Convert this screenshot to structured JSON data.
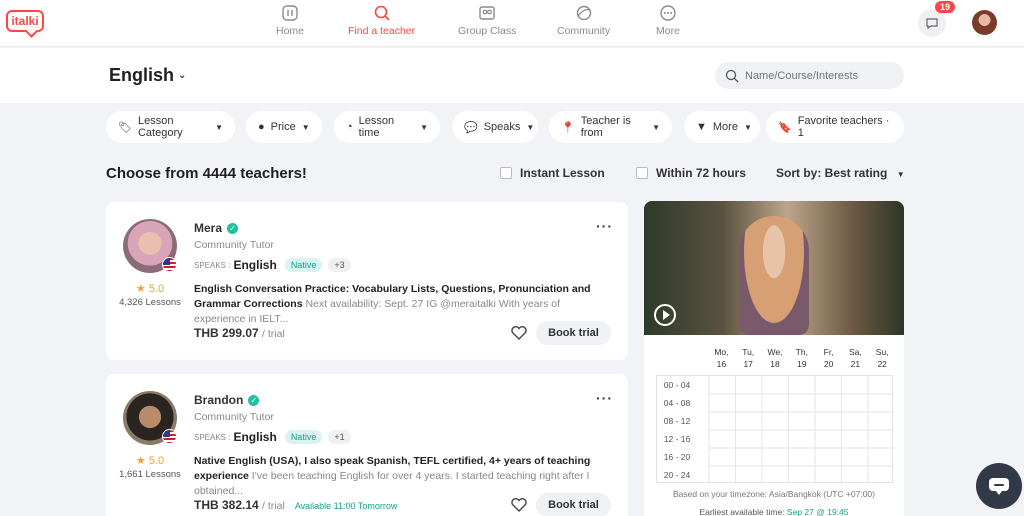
{
  "brand": {
    "logo_text": "italki",
    "accent": "#ff4545",
    "teal": "#14a08a"
  },
  "nav": {
    "items": [
      {
        "label": "Home",
        "icon": "home-icon"
      },
      {
        "label": "Find a teacher",
        "icon": "search-icon",
        "active": true
      },
      {
        "label": "Group Class",
        "icon": "group-class-icon"
      },
      {
        "label": "Community",
        "icon": "community-icon"
      },
      {
        "label": "More",
        "icon": "more-dots-icon"
      }
    ],
    "notification_count": "19"
  },
  "header": {
    "language": "English",
    "search_placeholder": "Name/Course/Interests"
  },
  "filters": [
    {
      "label": "Lesson Category",
      "icon": "tag-icon"
    },
    {
      "label": "Price",
      "icon": "price-icon"
    },
    {
      "label": "Lesson time",
      "icon": "clock-icon"
    },
    {
      "label": "Speaks",
      "icon": "speech-icon"
    },
    {
      "label": "Teacher is from",
      "icon": "location-pin-icon"
    },
    {
      "label": "More",
      "icon": "filter-icon"
    },
    {
      "label": "Favorite teachers · 1",
      "icon": "bookmark-icon"
    }
  ],
  "results": {
    "count_text": "Choose from 4444 teachers!",
    "instant_label": "Instant Lesson",
    "within_label": "Within 72 hours",
    "sort_label": "Sort by: Best rating"
  },
  "teachers": [
    {
      "name": "Mera",
      "type": "Community Tutor",
      "speaks_label": "SPEAKS :",
      "language": "English",
      "native": "Native",
      "extra": "+3",
      "rating": "5.0",
      "lessons": "4,326 Lessons",
      "title": "English Conversation Practice: Vocabulary Lists, Questions, Pronunciation and Grammar Corrections",
      "subtitle": "Next availability: Sept. 27 IG @meraitalki With years of experience in IELT...",
      "price": "THB 299.07",
      "per": "/ trial",
      "availability": "",
      "book": "Book trial"
    },
    {
      "name": "Brandon",
      "type": "Community Tutor",
      "speaks_label": "SPEAKS :",
      "language": "English",
      "native": "Native",
      "extra": "+1",
      "rating": "5.0",
      "lessons": "1,661 Lessons",
      "title": "Native English (USA), I also speak Spanish, TEFL certified, 4+ years of teaching experience",
      "subtitle": "I've been teaching English for over 4 years. I started teaching right after I obtained...",
      "price": "THB 382.14",
      "per": "/ trial",
      "availability": "Available 11:00 Tomorrow",
      "book": "Book trial"
    }
  ],
  "schedule": {
    "days": [
      {
        "dow": "Mo,",
        "date": "16"
      },
      {
        "dow": "Tu,",
        "date": "17"
      },
      {
        "dow": "We,",
        "date": "18"
      },
      {
        "dow": "Th,",
        "date": "19"
      },
      {
        "dow": "Fr,",
        "date": "20"
      },
      {
        "dow": "Sa,",
        "date": "21"
      },
      {
        "dow": "Su,",
        "date": "22"
      }
    ],
    "slots": [
      "00 - 04",
      "04 - 08",
      "08 - 12",
      "12 - 16",
      "16 - 20",
      "20 - 24"
    ],
    "timezone_text": "Based on your timezone: Asia/Bangkok (UTC +07:00)",
    "earliest_label": "Earliest available time:",
    "earliest_value": "Sep 27 @ 19:45"
  }
}
